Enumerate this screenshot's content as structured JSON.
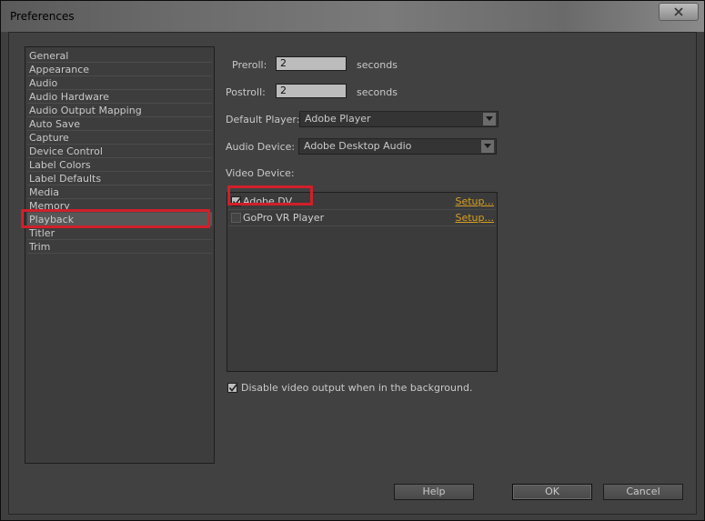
{
  "window": {
    "title": "Preferences"
  },
  "categories": [
    {
      "label": "General"
    },
    {
      "label": "Appearance"
    },
    {
      "label": "Audio"
    },
    {
      "label": "Audio Hardware"
    },
    {
      "label": "Audio Output Mapping"
    },
    {
      "label": "Auto Save"
    },
    {
      "label": "Capture"
    },
    {
      "label": "Device Control"
    },
    {
      "label": "Label Colors"
    },
    {
      "label": "Label Defaults"
    },
    {
      "label": "Media"
    },
    {
      "label": "Memory"
    },
    {
      "label": "Playback",
      "selected": true
    },
    {
      "label": "Titler"
    },
    {
      "label": "Trim"
    }
  ],
  "playback": {
    "preroll_label": "Preroll:",
    "preroll_value": "2",
    "postroll_label": "Postroll:",
    "postroll_value": "2",
    "seconds_label": "seconds",
    "default_player_label": "Default Player:",
    "default_player_value": "Adobe Player",
    "audio_device_label": "Audio Device:",
    "audio_device_value": "Adobe Desktop Audio",
    "video_device_label": "Video Device:",
    "video_devices": [
      {
        "name": "Adobe DV",
        "checked": true,
        "setup": "Setup..."
      },
      {
        "name": "GoPro VR Player",
        "checked": false,
        "setup": "Setup..."
      }
    ],
    "disable_background_label": "Disable video output when in the background.",
    "disable_background_checked": true
  },
  "buttons": {
    "help": "Help",
    "ok": "OK",
    "cancel": "Cancel"
  },
  "colors": {
    "highlight": "#d11f2a",
    "link": "#d8a021"
  }
}
